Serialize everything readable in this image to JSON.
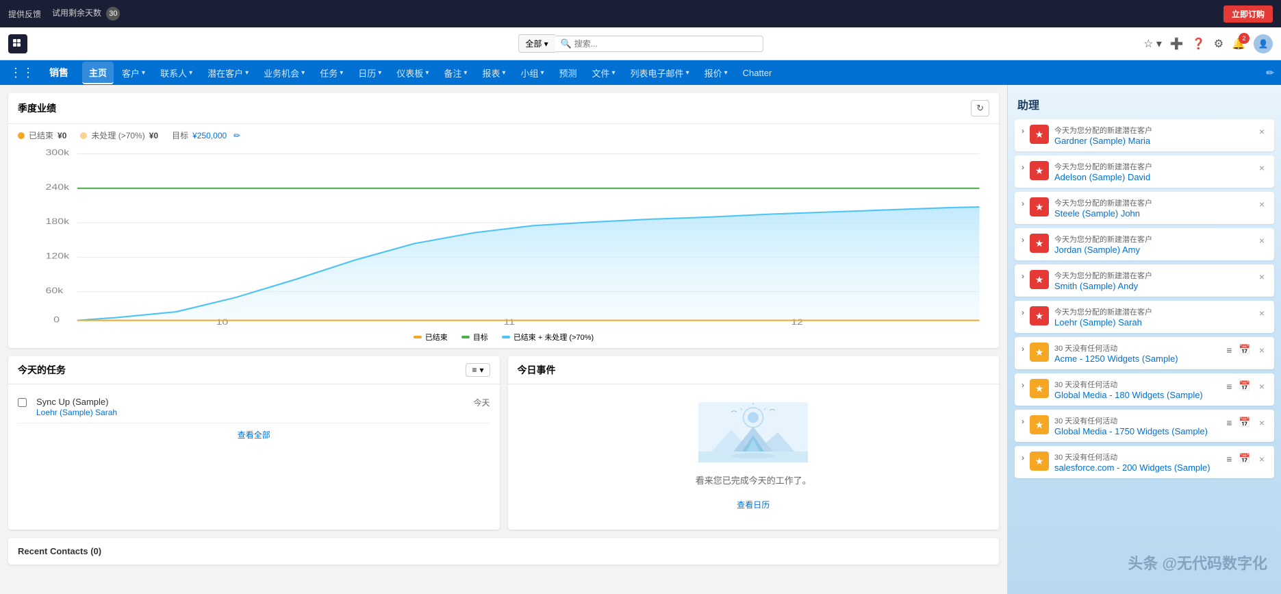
{
  "topbar": {
    "feedback_label": "提供反馈",
    "trial_label": "试用剩余天数",
    "trial_days": "30",
    "subscribe_label": "立即订购"
  },
  "navbar": {
    "search_all": "全部",
    "search_placeholder": "搜索...",
    "notif_count": "2"
  },
  "menubar": {
    "app_name": "销售",
    "items": [
      {
        "label": "主页",
        "active": true,
        "has_chevron": false
      },
      {
        "label": "客户",
        "active": false,
        "has_chevron": true
      },
      {
        "label": "联系人",
        "active": false,
        "has_chevron": true
      },
      {
        "label": "潜在客户",
        "active": false,
        "has_chevron": true
      },
      {
        "label": "业务机会",
        "active": false,
        "has_chevron": true
      },
      {
        "label": "任务",
        "active": false,
        "has_chevron": true
      },
      {
        "label": "日历",
        "active": false,
        "has_chevron": true
      },
      {
        "label": "仪表板",
        "active": false,
        "has_chevron": true
      },
      {
        "label": "备注",
        "active": false,
        "has_chevron": true
      },
      {
        "label": "报表",
        "active": false,
        "has_chevron": true
      },
      {
        "label": "小组",
        "active": false,
        "has_chevron": true
      },
      {
        "label": "预测",
        "active": false,
        "has_chevron": false
      },
      {
        "label": "文件",
        "active": false,
        "has_chevron": true
      },
      {
        "label": "列表电子邮件",
        "active": false,
        "has_chevron": true
      },
      {
        "label": "报价",
        "active": false,
        "has_chevron": true
      },
      {
        "label": "Chatter",
        "active": false,
        "has_chevron": false
      }
    ]
  },
  "performance": {
    "title": "季度业绩",
    "closed_label": "已结束",
    "closed_value": "¥0",
    "open_label": "未处理 (>70%)",
    "open_value": "¥0",
    "target_label": "目标",
    "target_value": "¥250,000",
    "y_axis": [
      "300k",
      "240k",
      "180k",
      "120k",
      "60k",
      "0"
    ],
    "x_axis": [
      "10",
      "11",
      "12"
    ],
    "legend": [
      {
        "label": "已结束",
        "color": "#f5a623"
      },
      {
        "label": "目标",
        "color": "#4caf50"
      },
      {
        "label": "已结束 + 未处理 (>70%)",
        "color": "#4fc3f7"
      }
    ]
  },
  "tasks": {
    "title": "今天的任务",
    "filter_label": "≡",
    "items": [
      {
        "name": "Sync Up (Sample)",
        "link": "Loehr (Sample) Sarah",
        "date": "今天"
      }
    ],
    "view_all": "查看全部"
  },
  "events": {
    "title": "今日事件",
    "empty_msg": "看来您已完成今天的工作了。",
    "view_calendar": "查看日历"
  },
  "recent_contacts": {
    "title": "Recent Contacts (0)"
  },
  "assistant": {
    "title": "助理",
    "items": [
      {
        "type": "red",
        "icon": "★",
        "label": "今天为您分配的新建潜在客户",
        "name": "Gardner (Sample) Maria",
        "has_actions": false
      },
      {
        "type": "red",
        "icon": "★",
        "label": "今天为您分配的新建潜在客户",
        "name": "Adelson (Sample) David",
        "has_actions": false
      },
      {
        "type": "red",
        "icon": "★",
        "label": "今天为您分配的新建潜在客户",
        "name": "Steele (Sample) John",
        "has_actions": false
      },
      {
        "type": "red",
        "icon": "★",
        "label": "今天为您分配的新建潜在客户",
        "name": "Jordan (Sample) Amy",
        "has_actions": false
      },
      {
        "type": "red",
        "icon": "★",
        "label": "今天为您分配的新建潜在客户",
        "name": "Smith (Sample) Andy",
        "has_actions": false
      },
      {
        "type": "red",
        "icon": "★",
        "label": "今天为您分配的新建潜在客户",
        "name": "Loehr (Sample) Sarah",
        "has_actions": false
      },
      {
        "type": "gold",
        "icon": "★",
        "label": "30 天没有任何活动",
        "name": "Acme - 1250 Widgets (Sample)",
        "has_actions": true
      },
      {
        "type": "gold",
        "icon": "★",
        "label": "30 天没有任何活动",
        "name": "Global Media - 180 Widgets (Sample)",
        "has_actions": true
      },
      {
        "type": "gold",
        "icon": "★",
        "label": "30 天没有任何活动",
        "name": "Global Media - 1750 Widgets (Sample)",
        "has_actions": true
      },
      {
        "type": "gold",
        "icon": "★",
        "label": "30 天没有任何活动",
        "name": "salesforce.com - 200 Widgets (Sample)",
        "has_actions": true
      }
    ]
  },
  "watermark": "头条 @无代码数字化"
}
